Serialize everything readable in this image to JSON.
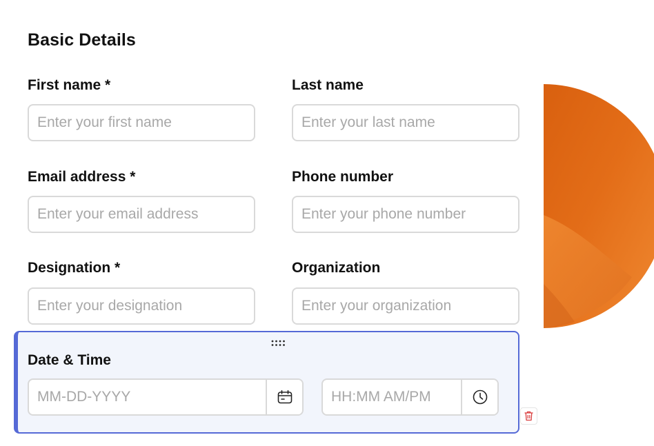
{
  "form": {
    "section_title": "Basic Details",
    "fields": {
      "first_name": {
        "label": "First name *",
        "placeholder": "Enter your first name"
      },
      "last_name": {
        "label": "Last name",
        "placeholder": "Enter your last name"
      },
      "email": {
        "label": "Email address *",
        "placeholder": "Enter your email address"
      },
      "phone": {
        "label": "Phone number",
        "placeholder": "Enter your phone number"
      },
      "designation": {
        "label": "Designation *",
        "placeholder": "Enter your designation"
      },
      "organization": {
        "label": "Organization",
        "placeholder": "Enter your organization"
      }
    },
    "datetime": {
      "label": "Date & Time",
      "date_placeholder": "MM-DD-YYYY",
      "time_placeholder": "HH:MM AM/PM",
      "date_icon": "calendar-icon",
      "time_icon": "clock-icon",
      "drag_icon": "drag-handle-icon",
      "delete_icon": "trash-icon"
    }
  },
  "colors": {
    "selection_border": "#5569d6",
    "selection_background": "#f2f5fc",
    "decor_orange": "#e06d1c",
    "delete_icon": "#d93b3b"
  }
}
